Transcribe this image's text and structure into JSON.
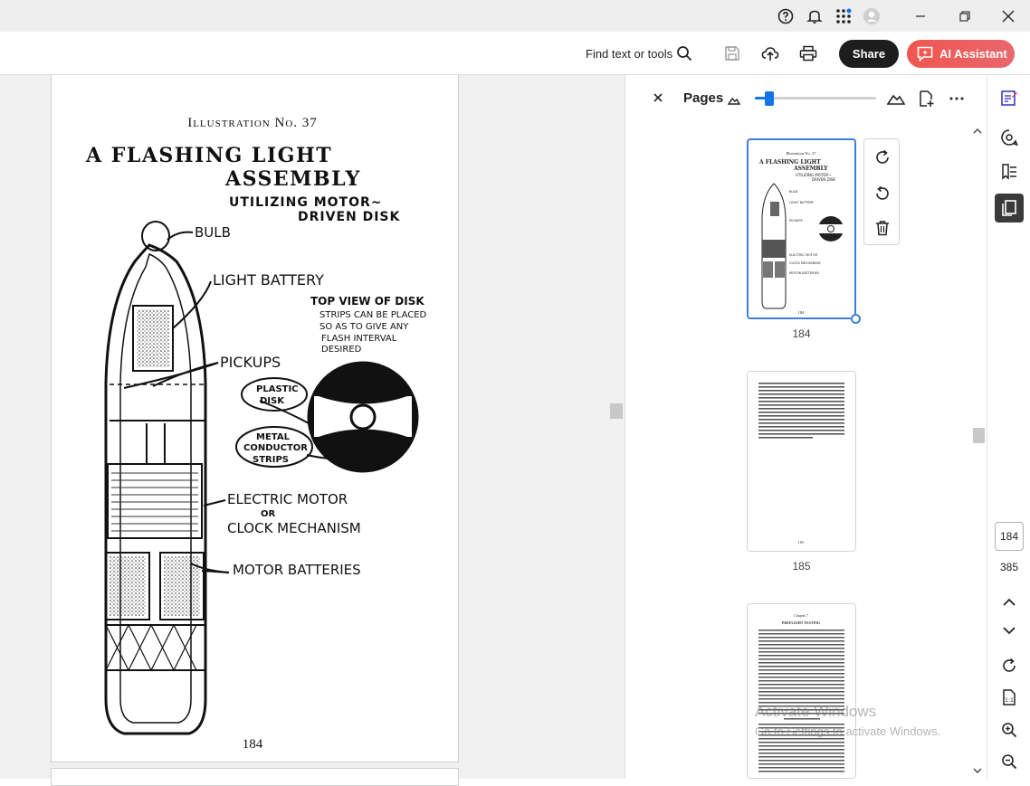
{
  "toolbar": {
    "find_label": "Find text or tools",
    "share_label": "Share",
    "ai_label": "AI Assistant"
  },
  "document": {
    "illustration_label": "Illustration No. 37",
    "title_line1": "A FLASHING LIGHT",
    "title_line2": "ASSEMBLY",
    "subtitle_line1": "UTILIZING MOTOR~",
    "subtitle_line2": "DRIVEN DISK",
    "labels": {
      "bulb": "BULB",
      "light_battery": "LIGHT BATTERY",
      "pickups": "PICKUPS",
      "top_view_title": "TOP VIEW OF DISK",
      "top_view_note_1": "STRIPS CAN BE PLACED",
      "top_view_note_2": "SO AS TO GIVE ANY",
      "top_view_note_3": "FLASH INTERVAL",
      "top_view_note_4": "DESIRED",
      "plastic_disk_1": "PLASTIC",
      "plastic_disk_2": "DISK",
      "metal_strips_1": "METAL",
      "metal_strips_2": "CONDUCTOR",
      "metal_strips_3": "STRIPS",
      "electric_motor": "ELECTRIC MOTOR",
      "or": "OR",
      "clock_mechanism": "CLOCK MECHANISM",
      "motor_batteries": "MOTOR BATTERIES"
    },
    "page_number": "184"
  },
  "pages_panel": {
    "title": "Pages",
    "zoom_level": 0.12,
    "thumbnails": [
      {
        "number": "184",
        "selected": true
      },
      {
        "number": "185",
        "selected": false
      },
      {
        "number": "",
        "selected": false
      }
    ],
    "thumb_text": {
      "t184_line1": "Illustration No. 37",
      "t184_line2": "A FLASHING LIGHT",
      "t184_line3": "ASSEMBLY",
      "t184_line4": "UTILIZING MOTOR~",
      "t184_line5": "DRIVEN DISK",
      "t184_page": "184",
      "t185_page": "185",
      "t186_chapter": "Chapter 7",
      "t186_heading": "PREFLIGHT TESTING"
    }
  },
  "rail": {
    "current_page": "184",
    "total_pages": "385"
  },
  "watermark": {
    "line1": "Activate Windows",
    "line2": "Go to Settings to activate Windows."
  },
  "colors": {
    "accent": "#1473e6",
    "share_bg": "#1d1d1d",
    "ai_gradient_start": "#f0564e",
    "selected_border": "#3f7fd9"
  }
}
